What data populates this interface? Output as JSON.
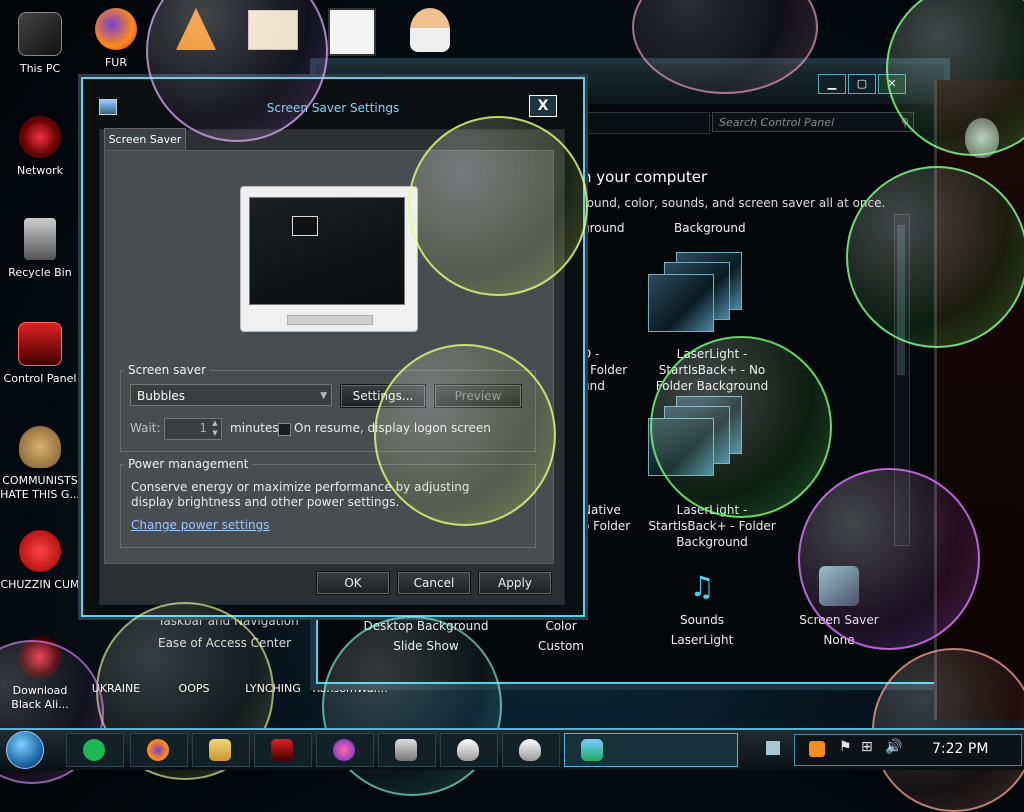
{
  "desktop": {
    "icons_left": [
      {
        "label": "This PC"
      },
      {
        "label": "Network"
      },
      {
        "label": "Recycle Bin"
      },
      {
        "label": "Control Panel"
      },
      {
        "label": "COMMUNISTS HATE THIS G..."
      },
      {
        "label": "CHUZZIN CUM"
      },
      {
        "label": "Download Black Ali..."
      }
    ],
    "icons_top": [
      {
        "label": "FUR"
      }
    ],
    "icons_bottom": [
      {
        "label": "UKRAINE"
      },
      {
        "label": "OOPS"
      },
      {
        "label": "LYNCHING"
      },
      {
        "label": "RansomWar..."
      }
    ]
  },
  "control_panel": {
    "search_placeholder": "Search Control Panel",
    "heading": "n your computer",
    "subheading": "round, color, sounds, and screen saver all at once.",
    "themes": [
      {
        "label": "ground"
      },
      {
        "label": "Background"
      },
      {
        "label": "D - \n- Folder\nund"
      },
      {
        "label": "LaserLight -\nStartIsBack+ - No\nFolder Background"
      },
      {
        "label": "Native\no Folder"
      },
      {
        "label": "LaserLight -\nStartIsBack+ - Folder\nBackground"
      }
    ],
    "sidebar_links": [
      {
        "label": "Taskbar and Navigation"
      },
      {
        "label": "Ease of Access Center"
      }
    ],
    "bottom_items": [
      {
        "title": "Desktop Background",
        "value": "Slide Show"
      },
      {
        "title": "Color",
        "value": "Custom"
      },
      {
        "title": "Sounds",
        "value": "LaserLight"
      },
      {
        "title": "Screen Saver",
        "value": "None"
      }
    ]
  },
  "dialog": {
    "title": "Screen Saver Settings",
    "close_label": "X",
    "tab_label": "Screen Saver",
    "screen_saver_group": "Screen saver",
    "selected_saver": "Bubbles",
    "settings_button": "Settings...",
    "preview_button": "Preview",
    "wait_label": "Wait:",
    "wait_value": "1",
    "minutes_label": "minutes",
    "resume_label": "On resume, display logon screen",
    "power_group": "Power management",
    "power_text": "Conserve energy or maximize performance by adjusting display brightness and other power settings.",
    "power_link": "Change power settings",
    "ok_button": "OK",
    "cancel_button": "Cancel",
    "apply_button": "Apply"
  },
  "taskbar": {
    "clock": "7:22 PM"
  },
  "colors": {
    "accent": "#4ad3f0",
    "link": "#9bc8ff"
  }
}
